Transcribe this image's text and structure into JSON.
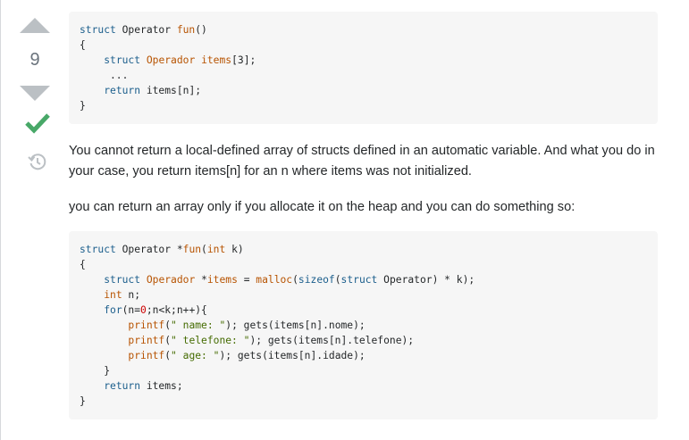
{
  "vote": {
    "count": "9"
  },
  "code_block_1": {
    "lines": [
      [
        {
          "t": "struct",
          "c": "kw"
        },
        {
          "t": " Operator ",
          "c": ""
        },
        {
          "t": "fun",
          "c": "fn"
        },
        {
          "t": "()",
          "c": ""
        }
      ],
      [
        {
          "t": "{",
          "c": ""
        }
      ],
      [
        {
          "t": "    ",
          "c": ""
        },
        {
          "t": "struct",
          "c": "kw"
        },
        {
          "t": " ",
          "c": ""
        },
        {
          "t": "Operador",
          "c": "ty"
        },
        {
          "t": " ",
          "c": ""
        },
        {
          "t": "items",
          "c": "ty"
        },
        {
          "t": "[3];",
          "c": ""
        }
      ],
      [
        {
          "t": "     ...",
          "c": ""
        }
      ],
      [
        {
          "t": "    ",
          "c": ""
        },
        {
          "t": "return",
          "c": "kw"
        },
        {
          "t": " items[n];",
          "c": ""
        }
      ],
      [
        {
          "t": "}",
          "c": ""
        }
      ]
    ]
  },
  "paragraph_1": "You cannot return a local-defined array of structs defined in an automatic variable. And what you do in your case, you return items[n] for an n where items was not initialized.",
  "paragraph_2": "you can return an array only if you allocate it on the heap and you can do something so:",
  "code_block_2": {
    "lines": [
      [
        {
          "t": "struct",
          "c": "kw"
        },
        {
          "t": " Operator *",
          "c": ""
        },
        {
          "t": "fun",
          "c": "fn"
        },
        {
          "t": "(",
          "c": ""
        },
        {
          "t": "int",
          "c": "ty"
        },
        {
          "t": " k)",
          "c": ""
        }
      ],
      [
        {
          "t": "{",
          "c": ""
        }
      ],
      [
        {
          "t": "    ",
          "c": ""
        },
        {
          "t": "struct",
          "c": "kw"
        },
        {
          "t": " ",
          "c": ""
        },
        {
          "t": "Operador",
          "c": "ty"
        },
        {
          "t": " *",
          "c": ""
        },
        {
          "t": "items",
          "c": "ty"
        },
        {
          "t": " = ",
          "c": ""
        },
        {
          "t": "malloc",
          "c": "fn"
        },
        {
          "t": "(",
          "c": ""
        },
        {
          "t": "sizeof",
          "c": "kw"
        },
        {
          "t": "(",
          "c": ""
        },
        {
          "t": "struct",
          "c": "kw"
        },
        {
          "t": " Operator) * k);",
          "c": ""
        }
      ],
      [
        {
          "t": "    ",
          "c": ""
        },
        {
          "t": "int",
          "c": "ty"
        },
        {
          "t": " n;",
          "c": ""
        }
      ],
      [
        {
          "t": "    ",
          "c": ""
        },
        {
          "t": "for",
          "c": "kw"
        },
        {
          "t": "(n=",
          "c": ""
        },
        {
          "t": "0",
          "c": "num"
        },
        {
          "t": ";n<k;n++){",
          "c": ""
        }
      ],
      [
        {
          "t": "        ",
          "c": ""
        },
        {
          "t": "printf",
          "c": "fn"
        },
        {
          "t": "(",
          "c": ""
        },
        {
          "t": "\" name: \"",
          "c": "str"
        },
        {
          "t": "); gets(items[n].nome);",
          "c": ""
        }
      ],
      [
        {
          "t": "        ",
          "c": ""
        },
        {
          "t": "printf",
          "c": "fn"
        },
        {
          "t": "(",
          "c": ""
        },
        {
          "t": "\" telefone: \"",
          "c": "str"
        },
        {
          "t": "); gets(items[n].telefone);",
          "c": ""
        }
      ],
      [
        {
          "t": "        ",
          "c": ""
        },
        {
          "t": "printf",
          "c": "fn"
        },
        {
          "t": "(",
          "c": ""
        },
        {
          "t": "\" age: \"",
          "c": "str"
        },
        {
          "t": "); gets(items[n].idade);",
          "c": ""
        }
      ],
      [
        {
          "t": "    }",
          "c": ""
        }
      ],
      [
        {
          "t": "    ",
          "c": ""
        },
        {
          "t": "return",
          "c": "kw"
        },
        {
          "t": " items;",
          "c": ""
        }
      ],
      [
        {
          "t": "}",
          "c": ""
        }
      ]
    ]
  },
  "icons": {
    "upvote": "arrow-up-icon",
    "downvote": "arrow-down-icon",
    "accepted": "checkmark-icon",
    "history": "history-icon"
  },
  "colors": {
    "accepted": "#48a868",
    "vote_arrow": "#bbc0c4",
    "code_bg": "#f6f6f6"
  }
}
